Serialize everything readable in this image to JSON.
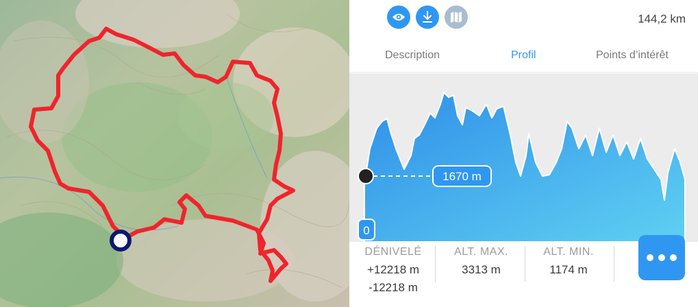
{
  "toolbar": {
    "icons": [
      "eye-icon",
      "download-icon",
      "map-icon"
    ],
    "distance": "144,2 km"
  },
  "tabs": [
    {
      "label": "Description",
      "active": false
    },
    {
      "label": "Profil",
      "active": true
    },
    {
      "label": "Points d’intérêt",
      "active": false
    }
  ],
  "profile": {
    "marker_altitude": "1670 m",
    "axis_min_label": "0",
    "colors": {
      "fill_top": "#2f8fe8",
      "fill_bottom": "#5fd0f2",
      "accent": "#2f97f1"
    }
  },
  "stats": {
    "elevation": {
      "label": "DÉNIVELÉ",
      "gain": "+12218 m",
      "loss": "-12218 m"
    },
    "alt_max": {
      "label": "ALT. MAX.",
      "value": "3313 m"
    },
    "alt_min": {
      "label": "ALT. MIN.",
      "value": "1174 m"
    }
  },
  "map": {
    "route_color": "#f0242c",
    "start_marker_color": "#0c1a6e"
  }
}
